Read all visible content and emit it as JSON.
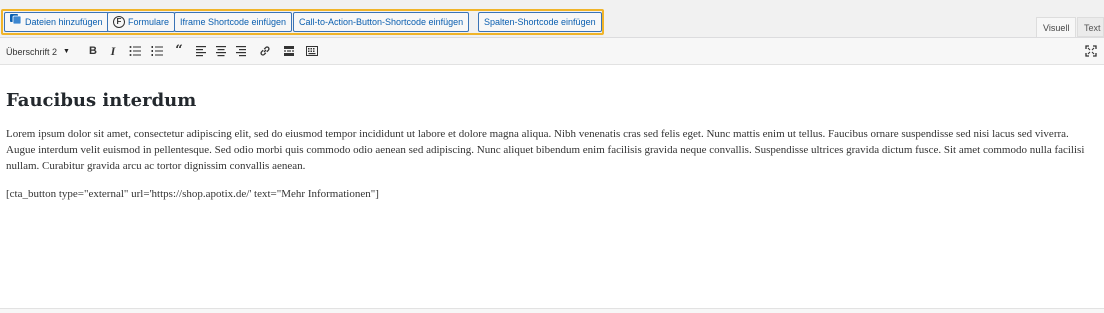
{
  "media_buttons": {
    "add_media": "Dateien hinzufügen",
    "forms": "Formulare",
    "iframe": "Iframe Shortcode einfügen",
    "cta": "Call-to-Action-Button-Shortcode einfügen",
    "columns": "Spalten-Shortcode einfügen"
  },
  "editor_tabs": {
    "visual": "Visuell",
    "text": "Text"
  },
  "toolbar": {
    "format_value": "Überschrift 2",
    "buttons": [
      "bold",
      "italic",
      "bulleted-list",
      "numbered-list",
      "blockquote",
      "align-left",
      "align-center",
      "align-right",
      "link",
      "read-more",
      "toolbar-toggle",
      "fullscreen"
    ]
  },
  "content": {
    "heading": "Faucibus interdum",
    "paragraph": "Lorem ipsum dolor sit amet, consectetur adipiscing elit, sed do eiusmod tempor incididunt ut labore et dolore magna aliqua. Nibh venenatis cras sed felis eget. Nunc mattis enim ut tellus. Faucibus ornare suspendisse sed nisi lacus sed viverra. Augue interdum velit euismod in pellentesque. Sed odio morbi quis commodo odio aenean sed adipiscing. Nunc aliquet bibendum enim facilisis gravida neque convallis. Suspendisse ultrices gravida dictum fusce. Sit amet commodo nulla facilisi nullam. Curabitur gravida arcu ac tortor dignissim convallis aenean.",
    "shortcode": "[cta_button type=\"external\" url='https://shop.apotix.de/' text=\"Mehr Informationen\"]"
  },
  "colors": {
    "highlight": "#f0b429",
    "button_border": "#3a73b6",
    "button_text": "#0b5fb0"
  }
}
